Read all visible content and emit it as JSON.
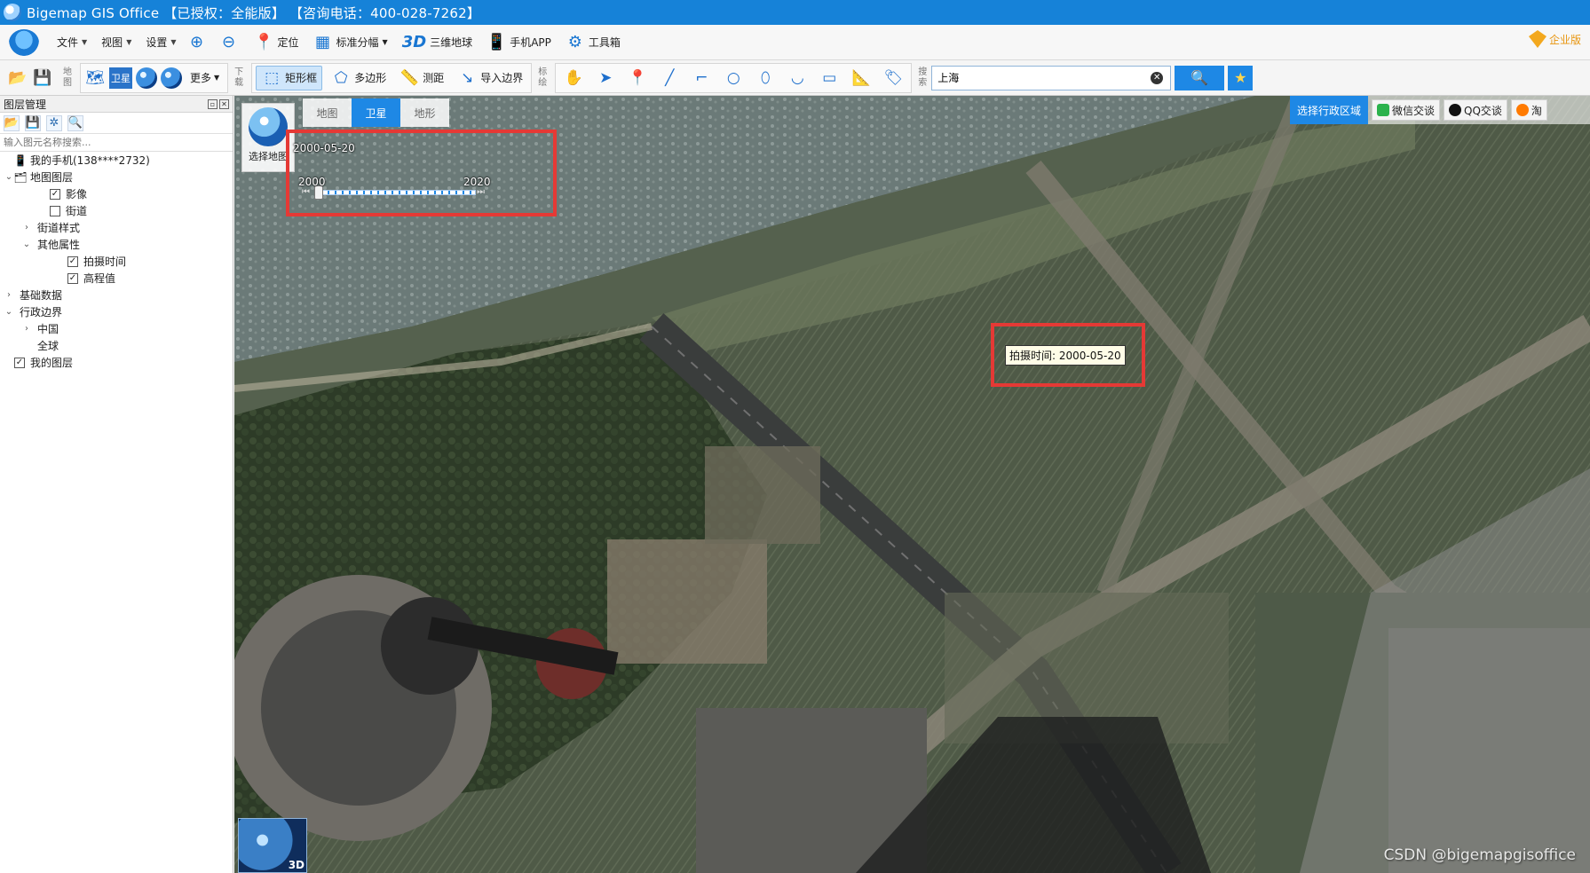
{
  "window": {
    "title": "Bigemap GIS Office 【已授权：全能版】 【咨询电话：400-028-7262】"
  },
  "menubar": {
    "menus": [
      "文件",
      "视图",
      "设置"
    ],
    "buttons": {
      "locate": "定位",
      "grid": "标准分幅",
      "globe3d_icon": "3D",
      "globe3d": "三维地球",
      "mobile": "手机APP",
      "toolbox": "工具箱"
    },
    "enterprise": "企业版"
  },
  "toolbar": {
    "map_group_label": "地图",
    "more": "更多",
    "download_label": "下载",
    "rect": "矩形框",
    "polygon": "多边形",
    "measure": "测距",
    "import_border": "导入边界",
    "mark_label": "标绘",
    "search_label": "搜索",
    "search_value": "上海"
  },
  "panel": {
    "title": "图层管理",
    "search_placeholder": "输入图元名称搜索...",
    "tree": [
      {
        "label": "我的手机(138****2732)",
        "indent": 0,
        "checkbox": null,
        "arrow": ""
      },
      {
        "label": "地图图层",
        "indent": 0,
        "checkbox": null,
        "arrow": "v"
      },
      {
        "label": "影像",
        "indent": 2,
        "checkbox": true,
        "arrow": ""
      },
      {
        "label": "街道",
        "indent": 2,
        "checkbox": false,
        "arrow": ""
      },
      {
        "label": "街道样式",
        "indent": 1,
        "checkbox": null,
        "arrow": ">"
      },
      {
        "label": "其他属性",
        "indent": 1,
        "checkbox": null,
        "arrow": "v"
      },
      {
        "label": "拍摄时间",
        "indent": 3,
        "checkbox": true,
        "arrow": ""
      },
      {
        "label": "高程值",
        "indent": 3,
        "checkbox": true,
        "arrow": ""
      },
      {
        "label": "基础数据",
        "indent": 0,
        "checkbox": null,
        "arrow": ">"
      },
      {
        "label": "行政边界",
        "indent": 0,
        "checkbox": null,
        "arrow": "v"
      },
      {
        "label": "中国",
        "indent": 1,
        "checkbox": null,
        "arrow": ">"
      },
      {
        "label": "全球",
        "indent": 1,
        "checkbox": null,
        "arrow": ""
      },
      {
        "label": "我的图层",
        "indent": 0,
        "checkbox": true,
        "arrow": ""
      }
    ]
  },
  "map": {
    "tabs": [
      "地图",
      "卫星",
      "地形"
    ],
    "active_tab": "卫星",
    "select_map": "选择地图",
    "region_select": "选择行政区域",
    "share": [
      "微信交谈",
      "QQ交谈",
      "淘"
    ],
    "timeline": {
      "current": "2000-05-20",
      "start": "2000",
      "end": "2020",
      "fraction": 0.0
    },
    "tooltip": "拍摄时间: 2000-05-20",
    "minimap_label": "3D",
    "watermark": "CSDN @bigemapgisoffice"
  },
  "colors": {
    "accent": "#1e88e5",
    "annotation": "#e53935",
    "titlebar": "#1682d8"
  }
}
